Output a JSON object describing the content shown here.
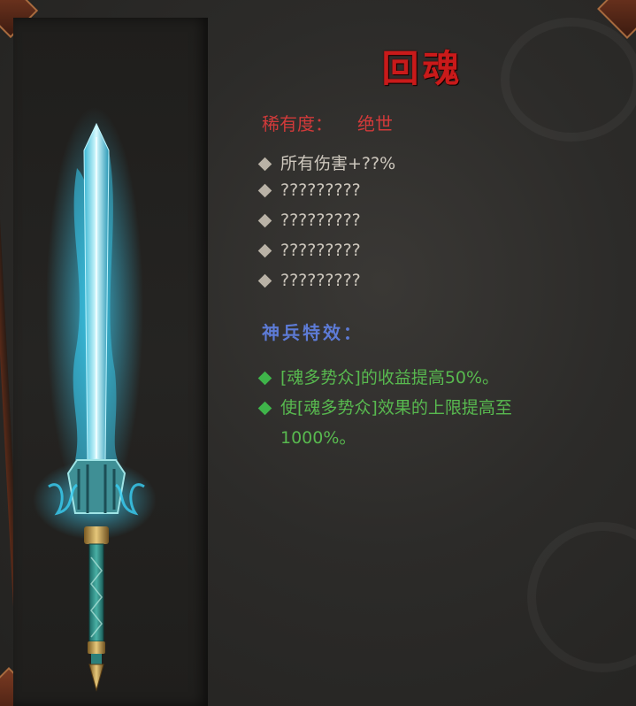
{
  "item": {
    "name": "回魂",
    "rarity_label": "稀有度：",
    "rarity_value": "绝世",
    "stats": [
      "所有伤害+??%",
      "?????????",
      "?????????",
      "?????????",
      "?????????"
    ],
    "special_title": "神兵特效：",
    "effects": [
      "[魂多势众]的收益提高50%。",
      "使[魂多势众]效果的上限提高至1000%。"
    ]
  },
  "colors": {
    "title": "#c91a1a",
    "rarity": "#d13a3a",
    "stat_text": "#cdc7bd",
    "special_title": "#5d7bd6",
    "effect_text": "#58b94f",
    "blade_glow": "#3fd8ff"
  }
}
